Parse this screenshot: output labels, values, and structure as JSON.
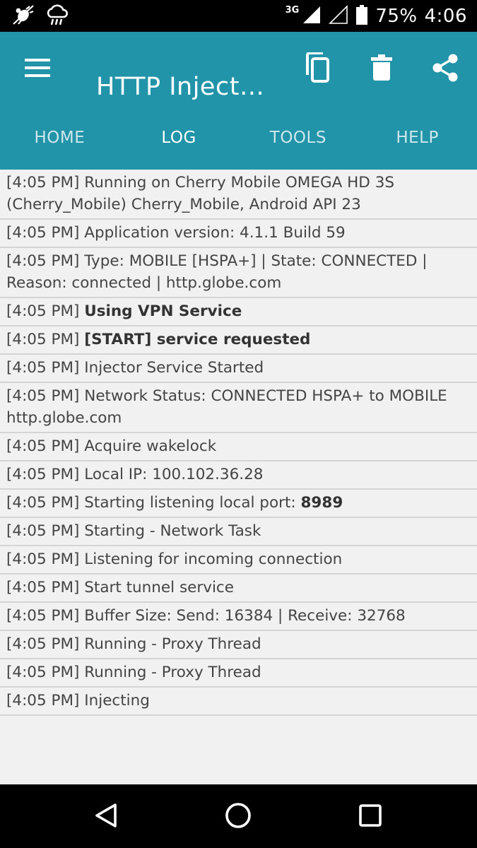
{
  "status_bar": {
    "network_type": "3G",
    "battery": "75%",
    "time": "4:06"
  },
  "app_bar": {
    "title": "HTTP Inject…",
    "icons": [
      "menu-icon",
      "copy-icon",
      "delete-icon",
      "share-icon"
    ]
  },
  "tabs": [
    {
      "label": "HOME",
      "active": false
    },
    {
      "label": "LOG",
      "active": true
    },
    {
      "label": "TOOLS",
      "active": false
    },
    {
      "label": "HELP",
      "active": false
    }
  ],
  "log": [
    {
      "ts": "[4:05 PM]",
      "text": "Running on Cherry Mobile OMEGA HD 3S (Cherry_Mobile) Cherry_Mobile, Android API 23",
      "bold": ""
    },
    {
      "ts": "[4:05 PM]",
      "text": "Application version: 4.1.1 Build 59",
      "bold": ""
    },
    {
      "ts": "[4:05 PM]",
      "text": "Type: MOBILE [HSPA+] | State: CONNECTED | Reason: connected | http.globe.com",
      "bold": ""
    },
    {
      "ts": "[4:05 PM]",
      "text": "",
      "bold": "Using VPN Service"
    },
    {
      "ts": "[4:05 PM]",
      "text": "",
      "bold": "[START] service requested"
    },
    {
      "ts": "[4:05 PM]",
      "text": "Injector Service Started",
      "bold": ""
    },
    {
      "ts": "[4:05 PM]",
      "text": "Network Status: CONNECTED HSPA+ to MOBILE http.globe.com",
      "bold": ""
    },
    {
      "ts": "[4:05 PM]",
      "text": "Acquire wakelock",
      "bold": ""
    },
    {
      "ts": "[4:05 PM]",
      "text": "Local IP: 100.102.36.28",
      "bold": ""
    },
    {
      "ts": "[4:05 PM]",
      "text": "Starting listening local port:",
      "bold": "8989"
    },
    {
      "ts": "[4:05 PM]",
      "text": "Starting - Network Task",
      "bold": ""
    },
    {
      "ts": "[4:05 PM]",
      "text": "Listening for incoming connection",
      "bold": ""
    },
    {
      "ts": "[4:05 PM]",
      "text": "Start tunnel service",
      "bold": ""
    },
    {
      "ts": "[4:05 PM]",
      "text": "Buffer Size: Send: 16384 | Receive: 32768",
      "bold": ""
    },
    {
      "ts": "[4:05 PM]",
      "text": "Running - Proxy Thread",
      "bold": ""
    },
    {
      "ts": "[4:05 PM]",
      "text": "Running - Proxy Thread",
      "bold": ""
    },
    {
      "ts": "[4:05 PM]",
      "text": "Injecting",
      "bold": ""
    }
  ],
  "nav_bar": {
    "icons": [
      "back-icon",
      "home-icon",
      "recents-icon"
    ]
  },
  "colors": {
    "app_bar": "#2194a9",
    "log_background": "#f1f1f1",
    "divider": "#d4d4d4",
    "text": "#444444"
  }
}
